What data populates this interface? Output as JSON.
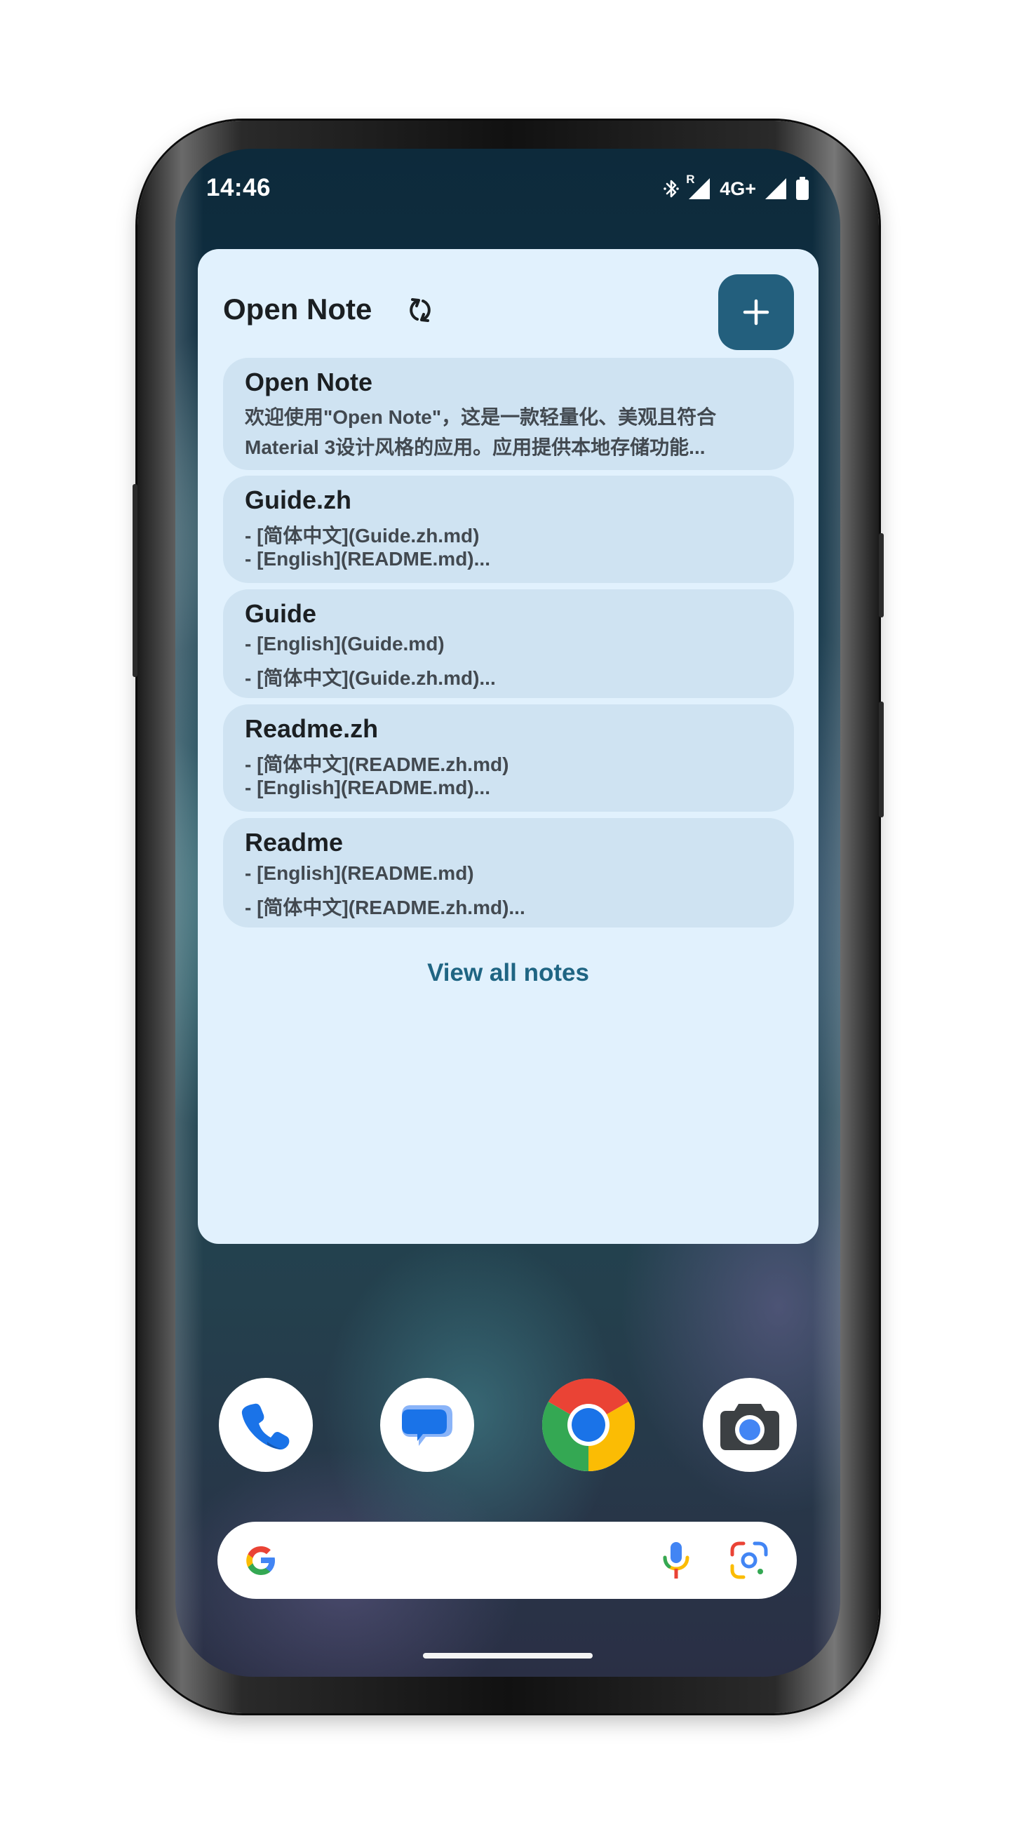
{
  "status_bar": {
    "time": "14:46",
    "roaming_label": "R",
    "network_label": "4G+",
    "icons": [
      "bluetooth-icon",
      "signal-roaming-icon",
      "signal-icon",
      "battery-icon"
    ]
  },
  "widget": {
    "title": "Open Note",
    "refresh_icon": "refresh-icon",
    "add_icon": "plus-icon",
    "notes": [
      {
        "title": "Open Note",
        "lines": [
          "欢迎使用\"Open Note\"，这是一款轻量化、美观且符合",
          "Material 3设计风格的应用。应用提供本地存储功能..."
        ]
      },
      {
        "title": "Guide.zh",
        "lines": [
          "- [简体中文](Guide.zh.md)",
          "- [English](README.md)..."
        ]
      },
      {
        "title": "Guide",
        "lines": [
          "- [English](Guide.md)",
          "- [简体中文](Guide.zh.md)..."
        ]
      },
      {
        "title": "Readme.zh",
        "lines": [
          "- [简体中文](README.zh.md)",
          "- [English](README.md)..."
        ]
      },
      {
        "title": "Readme",
        "lines": [
          "- [English](README.md)",
          "- [简体中文](README.zh.md)..."
        ]
      }
    ],
    "view_all_label": "View all notes"
  },
  "dock": {
    "apps": [
      "phone-icon",
      "messages-icon",
      "chrome-icon",
      "camera-icon"
    ]
  },
  "search_bar": {
    "icons": [
      "google-logo-icon",
      "microphone-icon",
      "google-lens-icon"
    ]
  },
  "colors": {
    "widget_bg": "#e1f1fd",
    "card_bg": "#cfe3f2",
    "accent": "#235f7d",
    "link": "#1f6583"
  }
}
